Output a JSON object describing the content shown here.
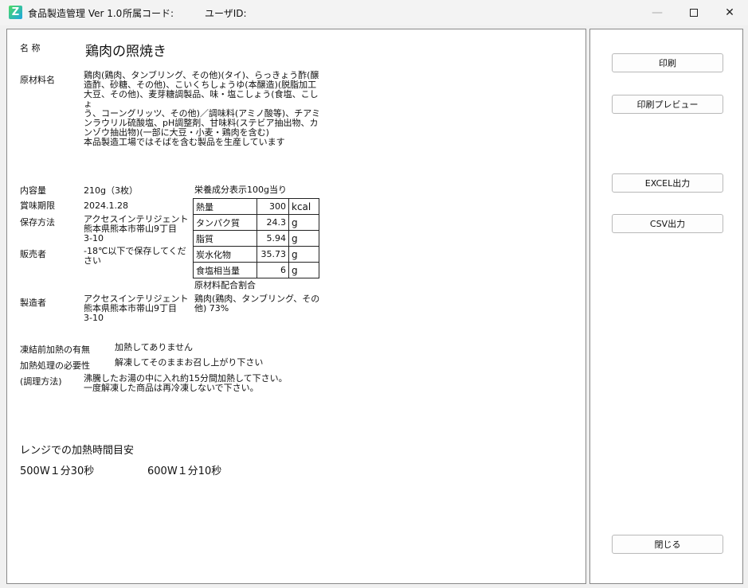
{
  "window": {
    "title": "食品製造管理 Ver 1.0",
    "dept_code_label": "所属コード:",
    "user_id_label": "ユーザID:",
    "minimize": "—",
    "close": "✕"
  },
  "label": {
    "name_label": "名 称",
    "product_name": "鶏肉の照焼き",
    "ingredients_label": "原材料名",
    "ingredients_lines": [
      "鶏肉(鶏肉、タンブリング、その他)(タイ)、らっきょう酢(醸",
      "造酢、砂糖、その他)、こいくちしょうゆ(本醸造)(脱脂加工",
      "大豆、その他)、麦芽糖調製品、味・塩こしょう(食塩、こしょ",
      "う、コーングリッツ、その他)／調味料(アミノ酸等)、チアミ",
      "ンラウリル硫酸塩、pH調整剤、甘味料(ステビア抽出物、カ",
      "ンゾウ抽出物)(一部に大豆・小麦・鶏肉を含む)",
      "本品製造工場ではそばを含む製品を生産しています"
    ],
    "net_label": "内容量",
    "net_value": "210g（3枚）",
    "expiry_label": "賞味期限",
    "expiry_value": "2024.1.28",
    "storage_label": "保存方法",
    "storage_lines": [
      "アクセスインテリジェント",
      "熊本県熊本市帯山9丁目",
      "3-10"
    ],
    "seller_label": "販売者",
    "seller_lines": [
      "-18℃以下で保存してくだ",
      "さい"
    ],
    "maker_label": "製造者",
    "maker_lines": [
      "アクセスインテリジェント",
      "熊本県熊本市帯山9丁目",
      "3-10"
    ],
    "nutrition_title": "栄養成分表示100g当り",
    "nutrition": [
      {
        "name": "熱量",
        "value": "300",
        "unit": "kcal"
      },
      {
        "name": "タンパク質",
        "value": "24.3",
        "unit": "g"
      },
      {
        "name": "脂質",
        "value": "5.94",
        "unit": "g"
      },
      {
        "name": "炭水化物",
        "value": "35.73",
        "unit": "g"
      },
      {
        "name": "食塩相当量",
        "value": "6",
        "unit": "g"
      }
    ],
    "ratio_title": "原材料配合割合",
    "ratio_lines": [
      "鶏肉(鶏肉、タンブリング、その",
      "他) 73%"
    ],
    "prefreeze_label": "凍結前加熱の有無",
    "prefreeze_value": "加熱してありません",
    "heating_label": "加熱処理の必要性",
    "heating_value": "解凍してそのままお召し上がり下さい",
    "cooking_label": "(調理方法)",
    "cooking_lines": [
      "沸騰したお湯の中に入れ約15分間加熱して下さい。",
      "一度解凍した商品は再冷凍しないで下さい。"
    ],
    "microwave_title": "レンジでの加熱時間目安",
    "microwave_500": "500W１分30秒",
    "microwave_600": "600W１分10秒"
  },
  "side": {
    "print": "印刷",
    "preview": "印刷プレビュー",
    "excel": "EXCEL出力",
    "csv": "CSV出力",
    "close": "閉じる"
  }
}
